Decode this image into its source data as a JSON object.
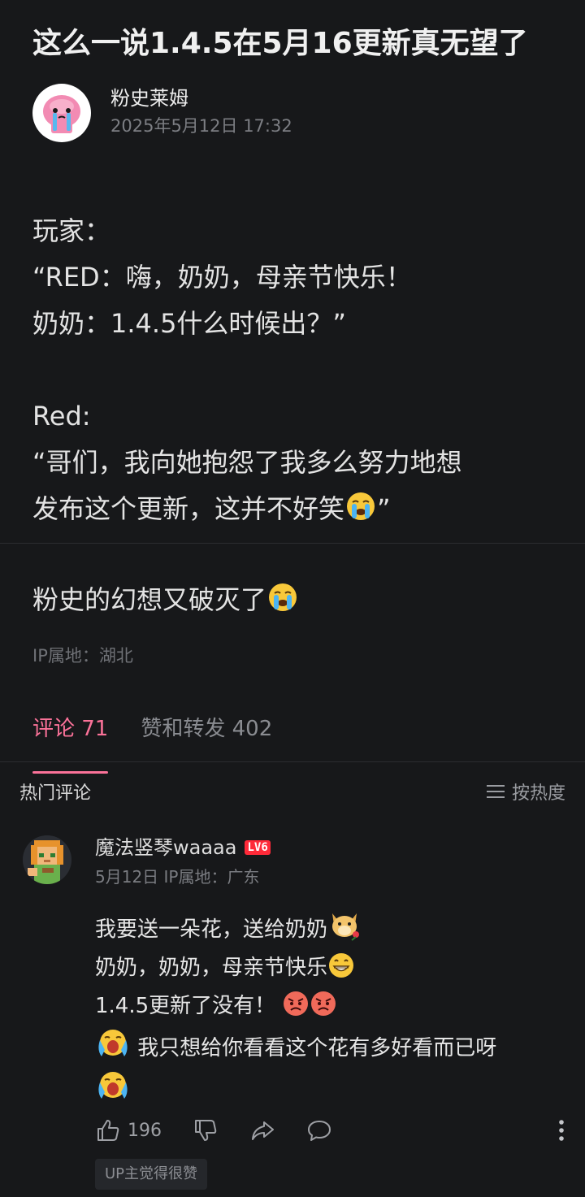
{
  "post": {
    "title": "这么一说1.4.5在5月16更新真无望了",
    "author": "粉史莱姆",
    "date": "2025年5月12日 17:32",
    "body_lines": [
      "玩家：",
      "“RED：嗨，奶奶，母亲节快乐！",
      "奶奶：1.4.5什么时候出？”",
      "Red:",
      "“哥们，我向她抱怨了我多么努力地想",
      "发布这个更新，这并不好笑",
      "”"
    ],
    "body2": "粉史的幻想又破灭了",
    "ip": "IP属地：湖北",
    "emoji_name": "crying-face-emoji"
  },
  "tabs": [
    {
      "label": "评论 71",
      "active": true
    },
    {
      "label": "赞和转发 402",
      "active": false
    }
  ],
  "comments_section": {
    "title": "热门评论",
    "sort_label": "按热度"
  },
  "comment": {
    "username": "魔法竖琴waaaa",
    "level": "LV6",
    "meta": "5月12日 IP属地：广东",
    "lines": [
      "我要送一朵花，送给奶奶",
      "奶奶，奶奶，母亲节快乐",
      "1.4.5更新了没有！",
      "我只想给你看看这个花有多好看而已呀"
    ],
    "likes": "196",
    "up_badge": "UP主觉得很赞"
  },
  "colors": {
    "background": "#17181a",
    "accent": "#fb7299",
    "level_badge": "#ff2a39"
  }
}
